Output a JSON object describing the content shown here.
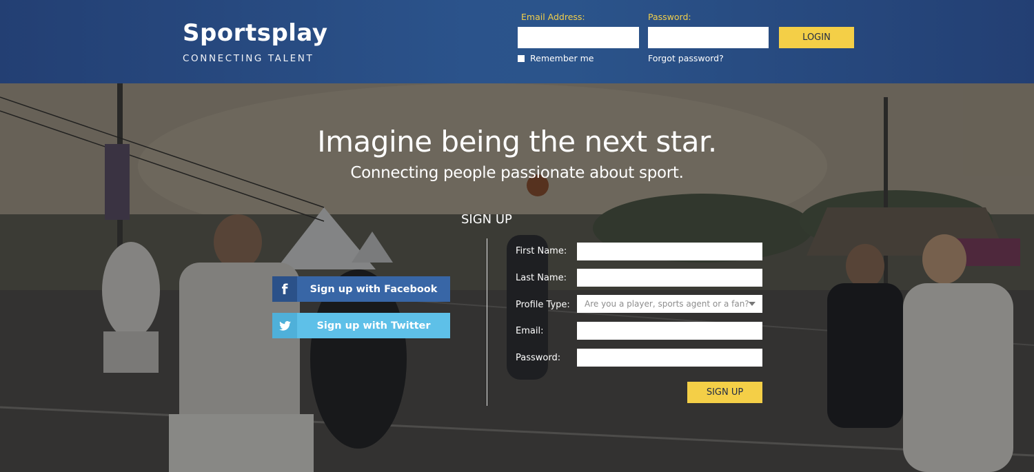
{
  "header": {
    "brand": "Sportsplay",
    "tagline": "CONNECTING TALENT",
    "email_label": "Email Address:",
    "email_value": "",
    "password_label": "Password:",
    "password_value": "",
    "login_label": "LOGIN",
    "remember_label": "Remember me",
    "remember_checked": false,
    "forgot_label": "Forgot password?"
  },
  "hero": {
    "headline": "Imagine being the next star.",
    "subheadline": "Connecting people passionate about sport."
  },
  "signup": {
    "title": "SIGN UP",
    "facebook_label": "Sign up with Facebook",
    "twitter_label": "Sign up with Twitter",
    "first_name_label": "First Name:",
    "last_name_label": "Last Name:",
    "profile_type_label": "Profile Type:",
    "profile_type_placeholder": "Are you a player, sports agent or a fan?",
    "email_label": "Email:",
    "password_label": "Password:",
    "submit_label": "SIGN UP"
  },
  "icons": {
    "facebook": "facebook-icon",
    "twitter": "twitter-icon",
    "dropdown": "chevron-down-icon"
  },
  "colors": {
    "header": "#2b538b",
    "accent": "#f4cf47",
    "facebook": "#3866a6",
    "twitter": "#5ec0e8"
  }
}
